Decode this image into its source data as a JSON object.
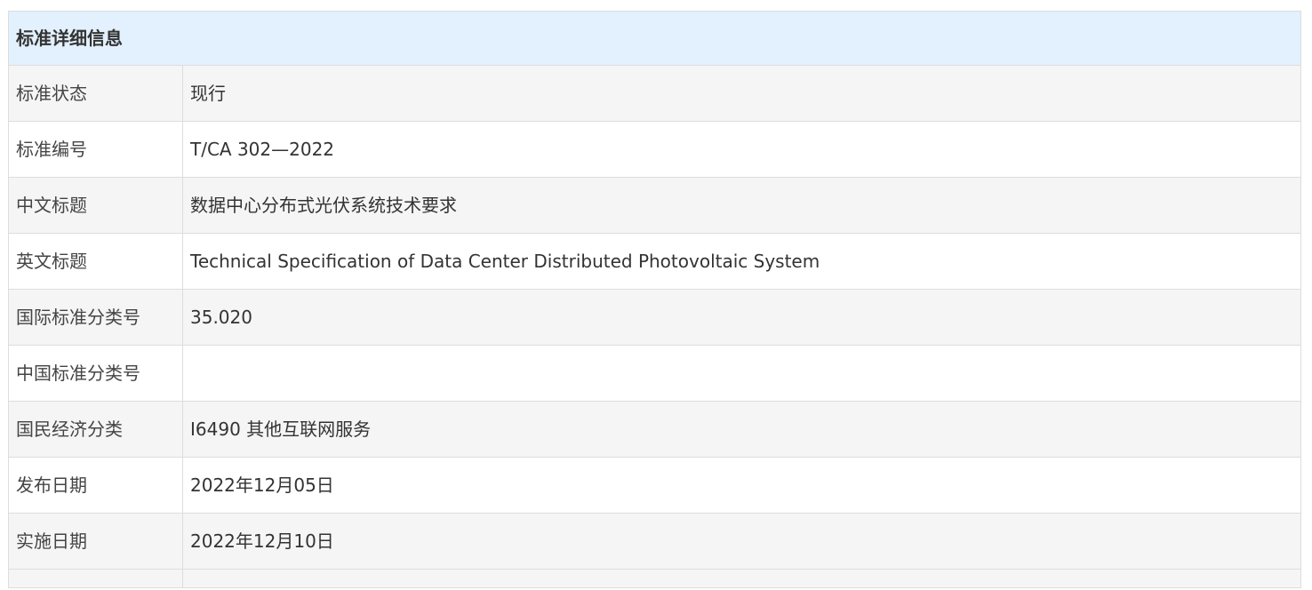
{
  "header": {
    "title": "标准详细信息"
  },
  "rows": [
    {
      "label": "标准状态",
      "value": "现行"
    },
    {
      "label": "标准编号",
      "value": "T/CA 302—2022"
    },
    {
      "label": "中文标题",
      "value": "数据中心分布式光伏系统技术要求"
    },
    {
      "label": "英文标题",
      "value": "Technical Specification of Data Center Distributed Photovoltaic System"
    },
    {
      "label": "国际标准分类号",
      "value": "35.020"
    },
    {
      "label": "中国标准分类号",
      "value": ""
    },
    {
      "label": "国民经济分类",
      "value": "I6490 其他互联网服务"
    },
    {
      "label": "发布日期",
      "value": "2022年12月05日"
    },
    {
      "label": "实施日期",
      "value": "2022年12月10日"
    }
  ],
  "colors": {
    "header_bg": "#e3f0fd",
    "stripe_bg": "#f5f5f5",
    "border": "#dddddd",
    "text": "#333333"
  }
}
